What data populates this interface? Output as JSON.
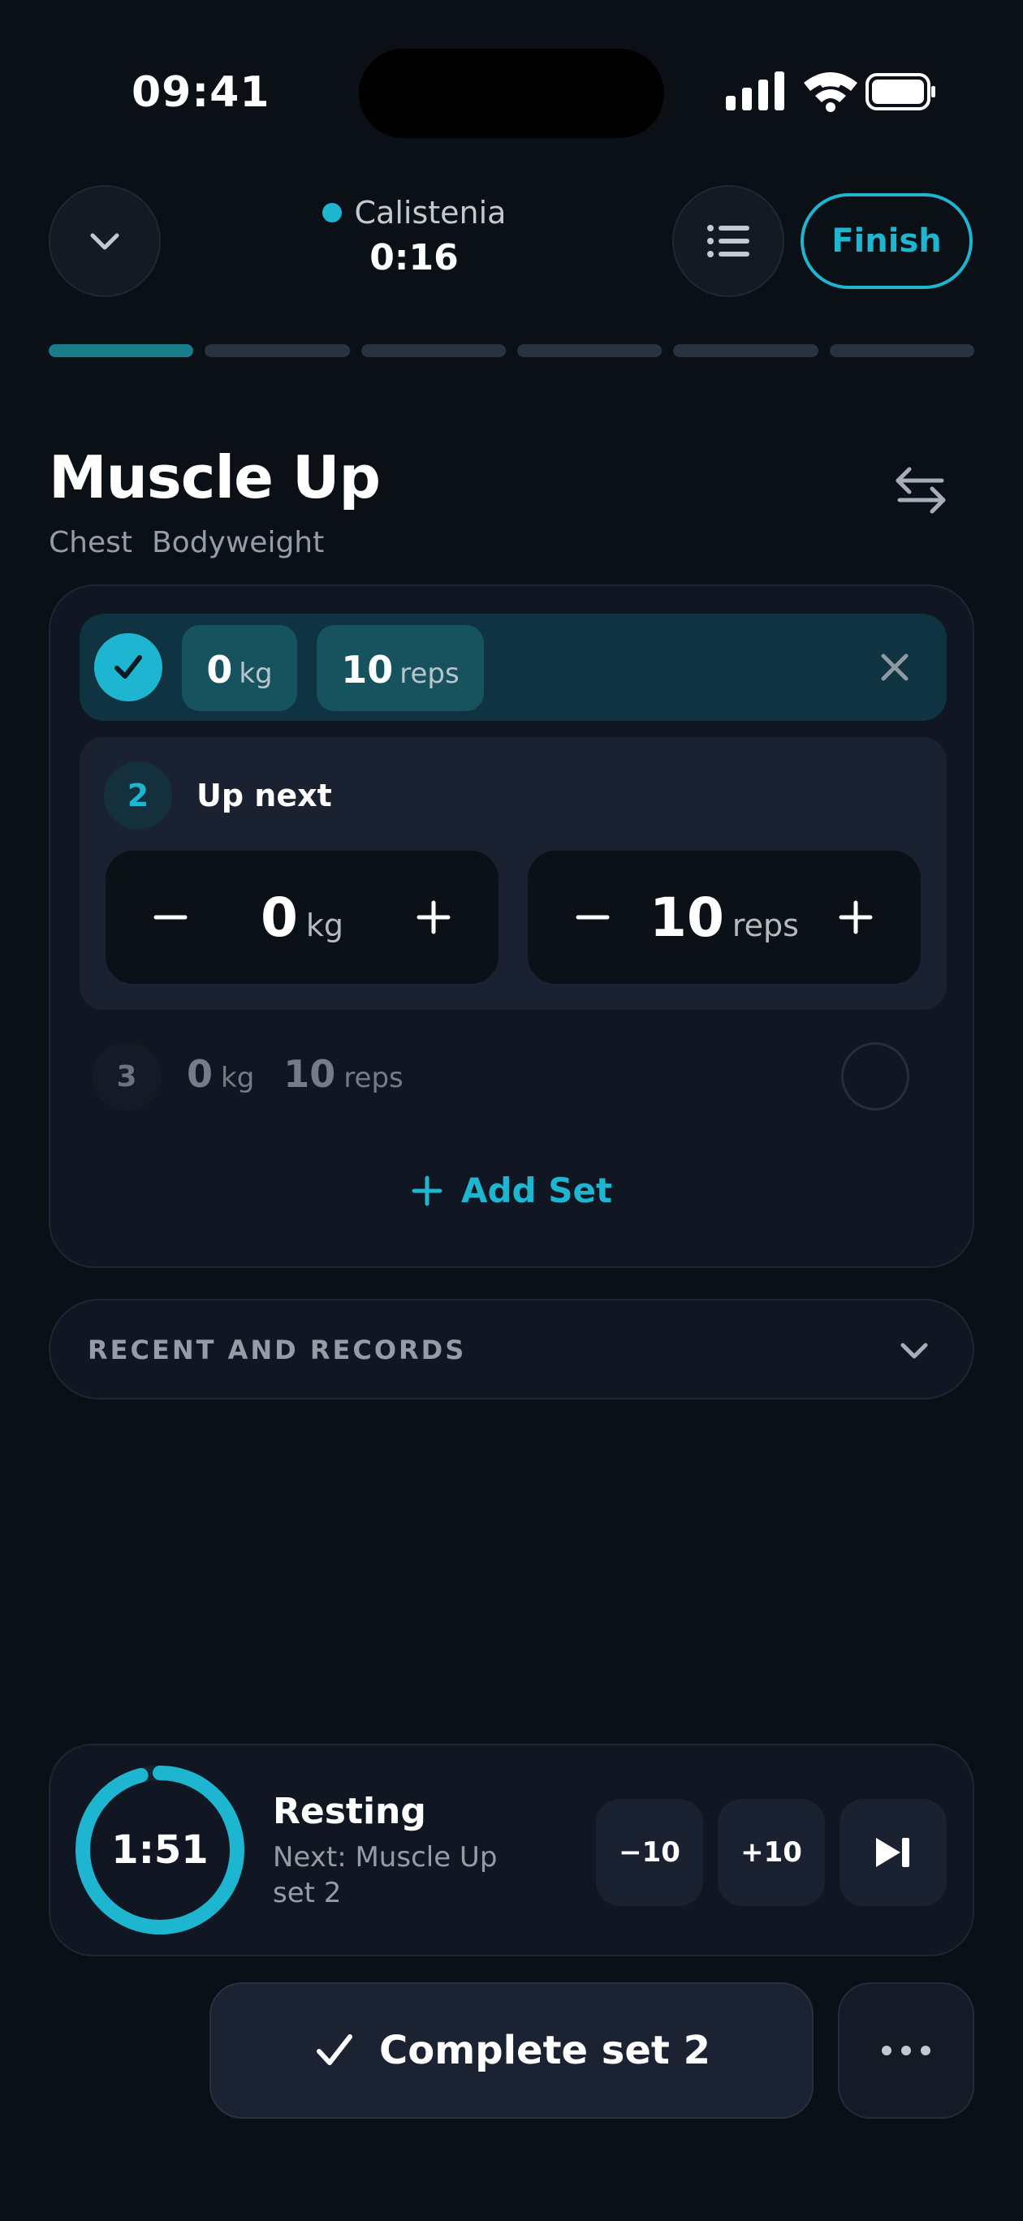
{
  "status_bar": {
    "time": "09:41"
  },
  "header": {
    "workout_name": "Calistenia",
    "elapsed": "0:16",
    "finish_label": "Finish",
    "progress": {
      "total_segments": 6,
      "completed_segments": 1
    }
  },
  "exercise": {
    "name": "Muscle Up",
    "tags": [
      "Chest",
      "Bodyweight"
    ]
  },
  "sets": {
    "completed": {
      "weight": "0",
      "weight_unit": "kg",
      "reps": "10",
      "reps_unit": "reps"
    },
    "current": {
      "number": "2",
      "label": "Up next",
      "weight": "0",
      "weight_unit": "kg",
      "reps": "10",
      "reps_unit": "reps"
    },
    "upcoming": {
      "number": "3",
      "weight": "0",
      "weight_unit": "kg",
      "reps": "10",
      "reps_unit": "reps"
    },
    "add_set_label": "Add Set"
  },
  "records": {
    "label": "RECENT AND RECORDS"
  },
  "rest_timer": {
    "time": "1:51",
    "remaining_fraction": 0.96,
    "title": "Resting",
    "next_line1": "Next: Muscle Up",
    "next_line2": "set 2",
    "minus_label": "−10",
    "plus_label": "+10"
  },
  "actions": {
    "complete_label": "Complete set 2"
  },
  "colors": {
    "accent": "#1db5d0",
    "background": "#0b0f16",
    "card": "#111722"
  }
}
